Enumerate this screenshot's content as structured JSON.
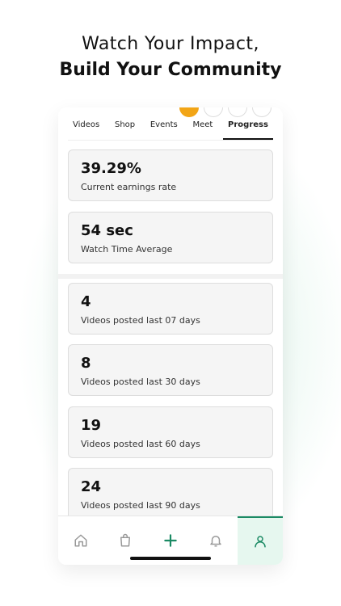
{
  "promo": {
    "line1": "Watch Your Impact,",
    "line2": "Build Your Community"
  },
  "tabs": [
    {
      "label": "Videos"
    },
    {
      "label": "Shop"
    },
    {
      "label": "Events"
    },
    {
      "label": "Meet"
    },
    {
      "label": "Progress",
      "active": true
    }
  ],
  "stats": [
    {
      "value": "39.29%",
      "label": "Current earnings rate"
    },
    {
      "value": "54 sec",
      "label": "Watch Time Average"
    },
    {
      "value": "4",
      "label": "Videos posted last 07 days"
    },
    {
      "value": "8",
      "label": "Videos posted last 30 days"
    },
    {
      "value": "19",
      "label": "Videos posted last 60 days"
    },
    {
      "value": "24",
      "label": "Videos posted last 90 days"
    }
  ],
  "nav": {
    "items": [
      {
        "icon": "home-icon"
      },
      {
        "icon": "bag-icon"
      },
      {
        "icon": "plus-icon"
      },
      {
        "icon": "bell-icon"
      },
      {
        "icon": "user-icon",
        "active": true
      }
    ],
    "accent": "#1b8a64"
  }
}
